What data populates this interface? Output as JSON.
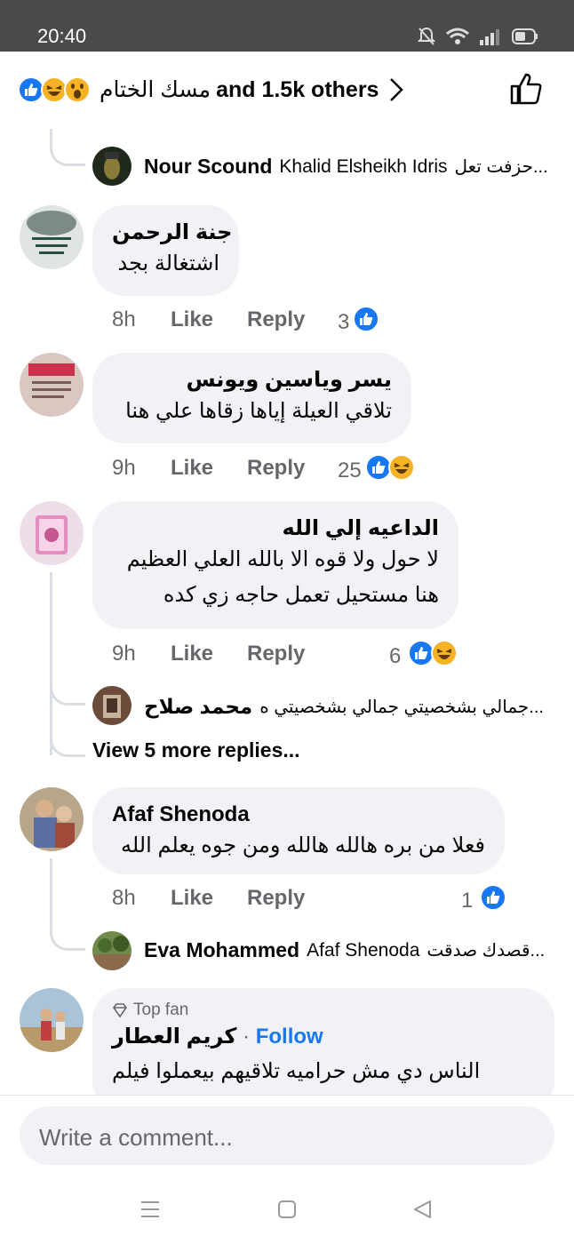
{
  "status": {
    "time": "20:40"
  },
  "reactions_bar": {
    "names": "مسك الختام",
    "others": "and 1.5k others",
    "icons": [
      "like-icon",
      "haha-icon",
      "wow-icon"
    ]
  },
  "comments": [
    {
      "name": "جنة الرحمن",
      "lines": [
        "اشتغالة بجد"
      ],
      "time": "8h",
      "like": "Like",
      "reply": "Reply",
      "count": "3",
      "reactions": [
        "like-icon"
      ]
    },
    {
      "name": "يسر وياسين ويونس",
      "lines": [
        "تلاقي العيلة إياها زقاها علي هنا"
      ],
      "time": "9h",
      "like": "Like",
      "reply": "Reply",
      "count": "25",
      "reactions": [
        "like-icon",
        "haha-icon"
      ]
    },
    {
      "name": "الداعيه إلي الله",
      "lines": [
        "لا حول ولا قوه الا بالله العلي العظيم",
        "هنا مستحيل تعمل حاجه زي كده"
      ],
      "time": "9h",
      "like": "Like",
      "reply": "Reply",
      "count": "6",
      "reactions": [
        "like-icon",
        "haha-icon"
      ]
    },
    {
      "name": "Afaf Shenoda",
      "lines": [
        "فعلا من بره هالله هالله ومن جوه يعلم الله"
      ],
      "time": "8h",
      "like": "Like",
      "reply": "Reply",
      "count": "1",
      "reactions": [
        "like-icon"
      ]
    },
    {
      "badge": "Top fan",
      "name": "كريم العطار",
      "follow": "Follow",
      "lines": [
        "الناس دي مش حراميه تلاقيهم بيعملوا فيلم"
      ]
    }
  ],
  "replies": [
    {
      "name": "Nour Scound",
      "tag": "Khalid Elsheikh Idris",
      "text": "حزفت تعل..."
    },
    {
      "name": "محمد صلاح",
      "tag": "",
      "text": "جمالي بشخصيتي جمالي بشخصيتي ه..."
    },
    {
      "name": "Eva Mohammed",
      "tag": "Afaf Shenoda",
      "text": "قصدك صدقت..."
    }
  ],
  "view_more": "View 5 more replies...",
  "composer": {
    "placeholder": "Write a comment..."
  },
  "colors": {
    "accent": "#1877f2",
    "bubble": "#f0f2f5",
    "meta": "#65676b"
  }
}
